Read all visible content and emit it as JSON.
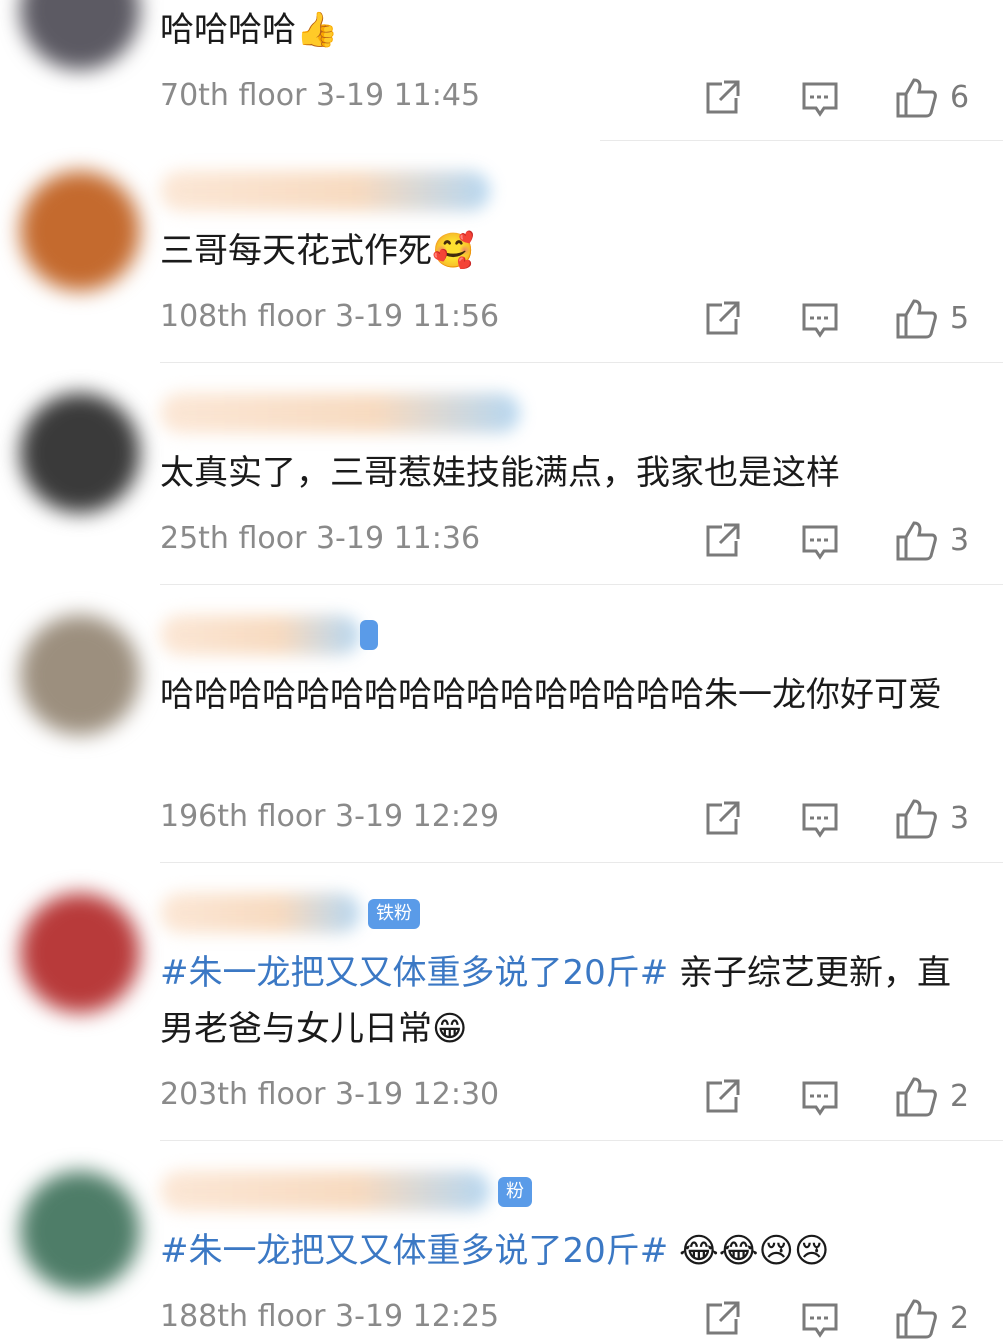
{
  "comments": [
    {
      "text": "哈哈哈哈👍",
      "floor": "70th floor 3-19 11:45",
      "likes": "6",
      "avatar_color": "#5c5a63",
      "has_name": false
    },
    {
      "text": "三哥每天花式作死🥰",
      "floor": "108th floor 3-19 11:56",
      "likes": "5",
      "avatar_color": "#c46a2e",
      "has_name": true
    },
    {
      "text": "太真实了，三哥惹娃技能满点，我家也是这样",
      "floor": "25th floor 3-19 11:36",
      "likes": "3",
      "avatar_color": "#3a3a3a",
      "has_name": true
    },
    {
      "text": "哈哈哈哈哈哈哈哈哈哈哈哈哈哈哈哈朱一龙你好可爱",
      "floor": "196th floor 3-19 12:29",
      "likes": "3",
      "avatar_color": "#9c8f7e",
      "has_name": true
    },
    {
      "hashtag": "#朱一龙把又又体重多说了20斤#",
      "text": " 亲子综艺更新，直男老爸与女儿日常😁",
      "badge": "铁粉",
      "floor": "203th floor 3-19 12:30",
      "likes": "2",
      "avatar_color": "#b83a3a",
      "has_name": true
    },
    {
      "hashtag": "#朱一龙把又又体重多说了20斤#",
      "text": " 😂😂😢😢",
      "badge": "粉",
      "floor": "188th floor 3-19 12:25",
      "likes": "2",
      "avatar_color": "#4e7d68",
      "has_name": true
    }
  ],
  "icons": {
    "share": "share-icon",
    "reply": "reply-icon",
    "like": "like-icon"
  },
  "colors": {
    "hashtag": "#3b78c4",
    "meta": "#8a8a8a",
    "badge": "#5a9be8"
  }
}
